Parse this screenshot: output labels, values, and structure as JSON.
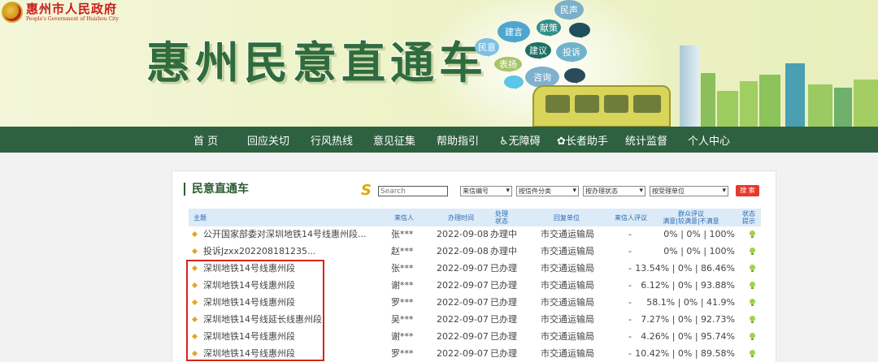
{
  "header": {
    "logo_cn": "惠州市人民政府",
    "logo_en": "People's Government of Huizhou City",
    "banner_title": "惠州民意直通车",
    "bubbles": [
      "民声",
      "建言",
      "献策",
      "民意",
      "表扬",
      "建议",
      "投诉",
      "咨询"
    ]
  },
  "nav": {
    "items": [
      "首 页",
      "回应关切",
      "行风热线",
      "意见征集",
      "帮助指引",
      "♿无障碍",
      "长者助手",
      "统计监督",
      "个人中心"
    ]
  },
  "panel": {
    "title": "民意直通车",
    "search_placeholder": "Search",
    "filters": [
      "来信编号",
      "按信件分类",
      "按办理状态",
      "按受理单位"
    ],
    "search_button": "搜 索",
    "columns": [
      "主题",
      "来信人",
      "办理时间",
      "处理状态",
      "回复单位",
      "来信人评议",
      "群众评议\n满意|较满意|不满意",
      "状态提示"
    ],
    "rows": [
      {
        "subject": "公开国家部委对深圳地铁14号线惠州段...",
        "sender": "张***",
        "date": "2022-09-08",
        "status": "办理中",
        "unit": "市交通运输局",
        "rating": "-",
        "public": "0% | 0% | 100%"
      },
      {
        "subject": "投诉Jzxx202208181235...",
        "sender": "赵***",
        "date": "2022-09-08",
        "status": "办理中",
        "unit": "市交通运输局",
        "rating": "-",
        "public": "0% | 0% | 100%"
      },
      {
        "subject": "深圳地铁14号线惠州段",
        "sender": "张***",
        "date": "2022-09-07",
        "status": "已办理",
        "unit": "市交通运输局",
        "rating": "-",
        "public": "13.54% | 0% | 86.46%"
      },
      {
        "subject": "深圳地铁14号线惠州段",
        "sender": "谢***",
        "date": "2022-09-07",
        "status": "已办理",
        "unit": "市交通运输局",
        "rating": "-",
        "public": "6.12% | 0% | 93.88%"
      },
      {
        "subject": "深圳地铁14号线惠州段",
        "sender": "罗***",
        "date": "2022-09-07",
        "status": "已办理",
        "unit": "市交通运输局",
        "rating": "-",
        "public": "58.1% | 0% | 41.9%"
      },
      {
        "subject": "深圳地铁14号线延长线惠州段",
        "sender": "吴***",
        "date": "2022-09-07",
        "status": "已办理",
        "unit": "市交通运输局",
        "rating": "-",
        "public": "7.27% | 0% | 92.73%"
      },
      {
        "subject": "深圳地铁14号线惠州段",
        "sender": "谢***",
        "date": "2022-09-07",
        "status": "已办理",
        "unit": "市交通运输局",
        "rating": "-",
        "public": "4.26% | 0% | 95.74%"
      },
      {
        "subject": "深圳地铁14号线惠州段",
        "sender": "罗***",
        "date": "2022-09-07",
        "status": "已办理",
        "unit": "市交通运输局",
        "rating": "-",
        "public": "10.42% | 0% | 89.58%"
      }
    ]
  },
  "colors": {
    "nav_bg": "#2e6140",
    "accent_green": "#2b5d32",
    "header_blue": "#dcebf7",
    "highlight_red": "#d6251c"
  }
}
